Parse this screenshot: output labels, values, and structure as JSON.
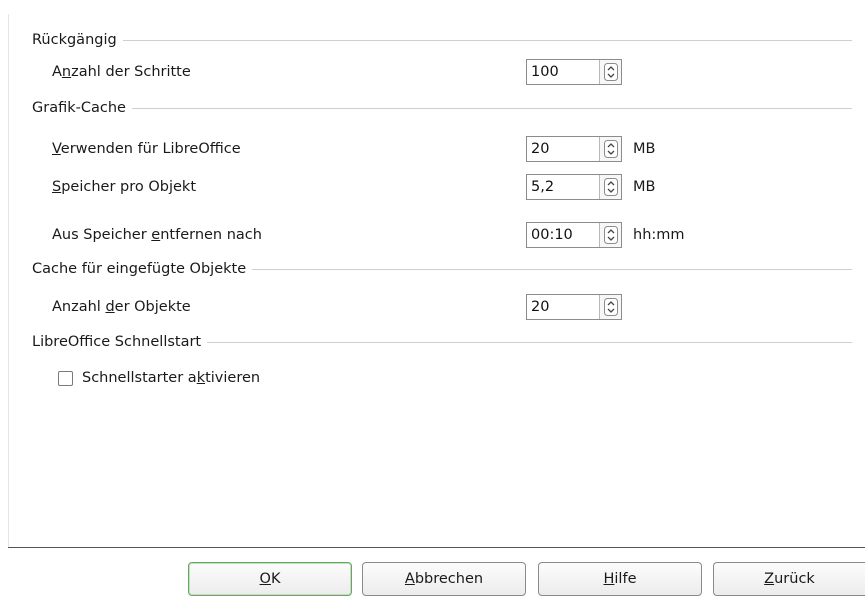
{
  "sections": {
    "undo": {
      "title": "Rückgängig",
      "steps": {
        "label_pre": "A",
        "label_u": "n",
        "label_post": "zahl der Schritte",
        "value": "100"
      }
    },
    "graphics_cache": {
      "title": "Grafik-Cache",
      "use_for": {
        "label_pre": "",
        "label_u": "V",
        "label_post": "erwenden für LibreOffice",
        "value": "20",
        "unit": "MB"
      },
      "per_object": {
        "label_pre": "",
        "label_u": "S",
        "label_post": "peicher pro Objekt",
        "value": "5,2",
        "unit": "MB"
      },
      "remove_after": {
        "label_pre": "Aus Speicher ",
        "label_u": "e",
        "label_post": "ntfernen nach",
        "value": "00:10",
        "unit": "hh:mm"
      }
    },
    "inserted_objects": {
      "title": "Cache für eingefügte Objekte",
      "count": {
        "label_pre": "Anzahl ",
        "label_u": "d",
        "label_post": "er Objekte",
        "value": "20"
      }
    },
    "quickstart": {
      "title": "LibreOffice Schnellstart",
      "enable": {
        "label_pre": "Schnellstarter a",
        "label_u": "k",
        "label_post": "tivieren",
        "checked": false
      }
    }
  },
  "buttons": {
    "ok": {
      "u": "O",
      "rest": "K"
    },
    "cancel": {
      "u": "A",
      "rest": "bbrechen"
    },
    "help": {
      "u": "H",
      "rest": "ilfe"
    },
    "back": {
      "u": "Z",
      "rest": "urück"
    }
  },
  "colors": {
    "default_button_border": "#6fa26a",
    "separator": "#cfcfcf"
  }
}
